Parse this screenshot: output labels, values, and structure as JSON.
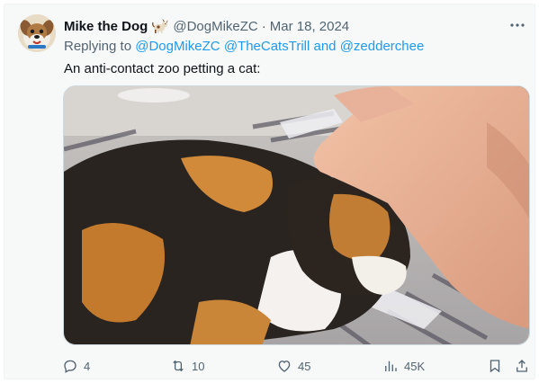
{
  "author": {
    "display_name": "Mike the Dog",
    "handle": "@DogMikeZC",
    "separator": "·",
    "date": "Mar 18, 2024",
    "emoji_icon": "dog-emoji"
  },
  "reply": {
    "prefix": "Replying to",
    "mentions": [
      "@DogMikeZC",
      "@TheCatsTrill",
      "@zedderchee"
    ],
    "joiner": "and"
  },
  "tweet": {
    "text": "An anti-contact zoo petting a cat:"
  },
  "actions": {
    "replies": "4",
    "reposts": "10",
    "likes": "45",
    "views": "45K"
  },
  "colors": {
    "link": "#1d9bf0",
    "muted": "#536471",
    "text": "#0f1419",
    "card_background": "#f7f9f9"
  },
  "icons": [
    "more-icon",
    "reply-icon",
    "repost-icon",
    "like-icon",
    "views-icon",
    "bookmark-icon",
    "share-icon"
  ]
}
